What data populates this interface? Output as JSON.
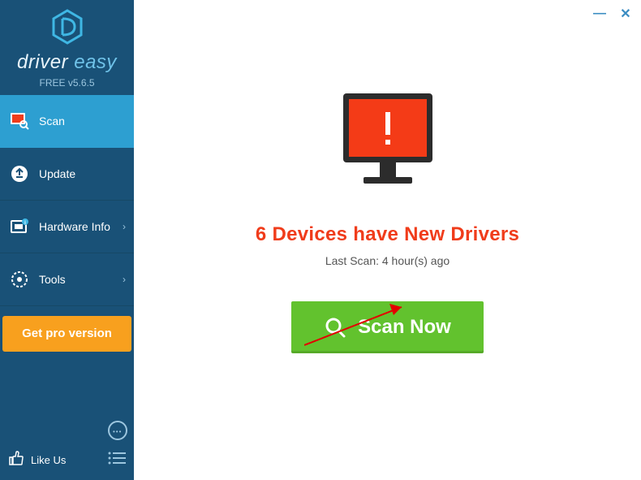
{
  "brand": {
    "name_part1": "driver ",
    "name_part2": "easy",
    "version": "FREE v5.6.5"
  },
  "sidebar": {
    "items": [
      {
        "label": "Scan"
      },
      {
        "label": "Update"
      },
      {
        "label": "Hardware Info"
      },
      {
        "label": "Tools"
      }
    ],
    "cta": "Get pro version",
    "like_label": "Like Us"
  },
  "main": {
    "headline": "6 Devices have New Drivers",
    "last_scan": "Last Scan: 4 hour(s) ago",
    "scan_button": "Scan Now"
  },
  "window": {
    "minimize": "—",
    "close": "✕"
  },
  "colors": {
    "sidebar": "#195177",
    "active": "#2d9fd1",
    "cta": "#f8a01e",
    "headline": "#f03c1b",
    "scan": "#62c22e"
  }
}
